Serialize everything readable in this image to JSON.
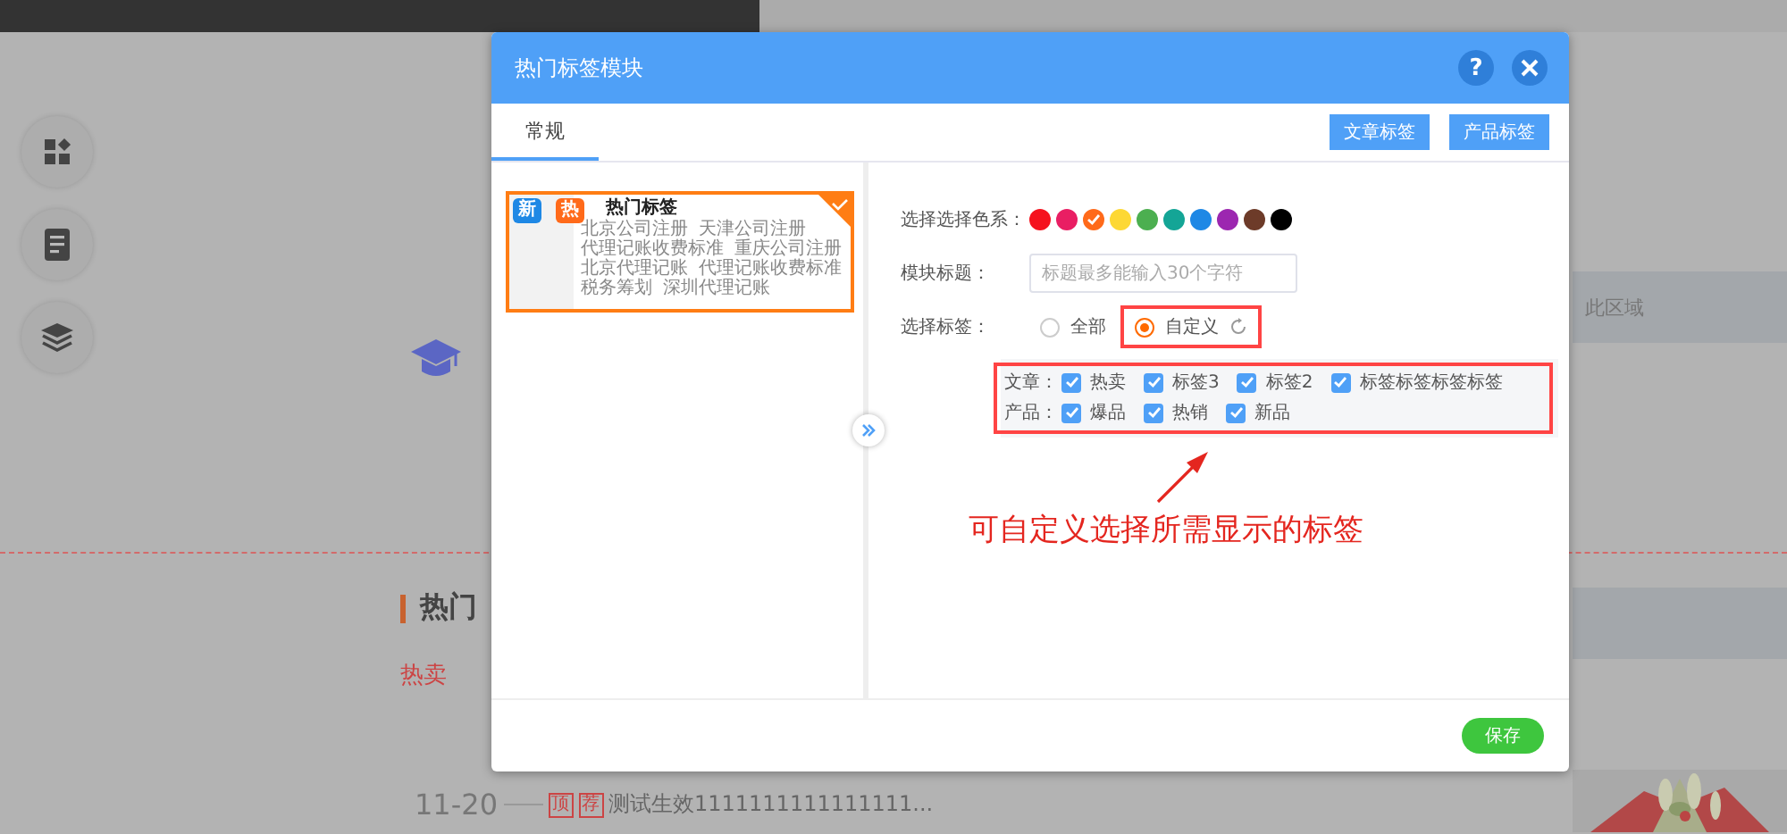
{
  "background": {
    "side_buttons": [
      {
        "kind": "apps"
      },
      {
        "kind": "document"
      },
      {
        "kind": "layers"
      }
    ],
    "band_text": "此区域",
    "section_heading": "热门",
    "tag_links": [
      "热卖"
    ],
    "news": {
      "date": "11-20",
      "badges": [
        "顶",
        "荐"
      ],
      "title": "测试生效1111111111111111..."
    }
  },
  "modal": {
    "title": "热门标签模块",
    "help": "?",
    "tabs": [
      {
        "label": "常规",
        "selected": true
      }
    ],
    "header_buttons": [
      "文章标签",
      "产品标签"
    ],
    "templates": [
      {
        "selected": true,
        "badges": [
          "新",
          "热"
        ],
        "title": "热门标签",
        "items": [
          "北京公司注册",
          "天津公司注册",
          "代理记账收费标准",
          "重庆公司注册",
          "北京代理记账",
          "代理记账收费标准",
          "税务筹划",
          "深圳代理记账"
        ]
      }
    ],
    "form": {
      "color_label": "选择选择色系：",
      "colors": [
        {
          "color": "#f5121e",
          "selected": false
        },
        {
          "color": "#e91e63",
          "selected": false
        },
        {
          "color": "#ff6a1a",
          "selected": true
        },
        {
          "color": "#fdd835",
          "selected": false
        },
        {
          "color": "#4caf50",
          "selected": false
        },
        {
          "color": "#14a596",
          "selected": false
        },
        {
          "color": "#1e88e5",
          "selected": false
        },
        {
          "color": "#9c27b0",
          "selected": false
        },
        {
          "color": "#6d3b29",
          "selected": false
        },
        {
          "color": "#000000",
          "selected": false
        }
      ],
      "title_label": "模块标题：",
      "title_field": {
        "placeholder": "标题最多能输入30个字符"
      },
      "tags_label": "选择标签：",
      "tag_modes": [
        {
          "label": "全部",
          "selected": false
        },
        {
          "label": "自定义",
          "selected": true
        }
      ],
      "tag_groups": [
        {
          "label": "文章：",
          "tags": [
            {
              "label": "热卖",
              "checked": true
            },
            {
              "label": "标签3",
              "checked": true
            },
            {
              "label": "标签2",
              "checked": true
            },
            {
              "label": "标签标签标签标签",
              "checked": true
            }
          ]
        },
        {
          "label": "产品：",
          "tags": [
            {
              "label": "爆品",
              "checked": true
            },
            {
              "label": "热销",
              "checked": true
            },
            {
              "label": "新品",
              "checked": true
            }
          ]
        }
      ]
    },
    "annotation": {
      "text": "可自定义选择所需显示的标签"
    },
    "save_button": "保存"
  }
}
